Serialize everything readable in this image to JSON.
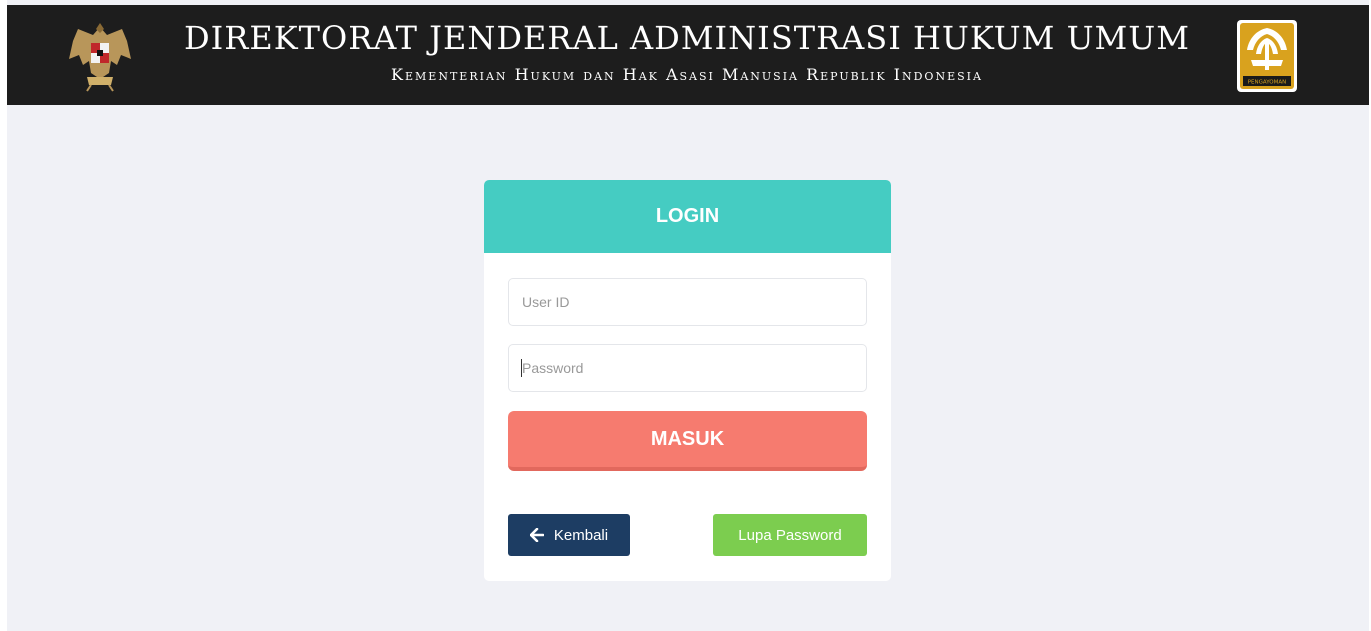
{
  "header": {
    "title": "DIREKTORAT JENDERAL ADMINISTRASI HUKUM UMUM",
    "subtitle": "Kementerian Hukum dan Hak Asasi Manusia Republik Indonesia",
    "right_logo_text": "PENGAYOMAN",
    "bg_color": "#1d1d1d"
  },
  "login": {
    "heading": "LOGIN",
    "userid_placeholder": "User ID",
    "password_placeholder": "Password",
    "submit_label": "MASUK",
    "back_label": "Kembali",
    "forgot_label": "Lupa Password"
  },
  "colors": {
    "accent_teal": "#45ccc2",
    "submit_salmon": "#f67b6f",
    "back_navy": "#1d3d63",
    "forgot_green": "#7ccd4f",
    "page_bg": "#f0f1f6"
  },
  "icons": {
    "left_emblem": "garuda-emblem-icon",
    "right_emblem": "pengayoman-logo-icon",
    "back_arrow": "arrow-left-icon"
  }
}
